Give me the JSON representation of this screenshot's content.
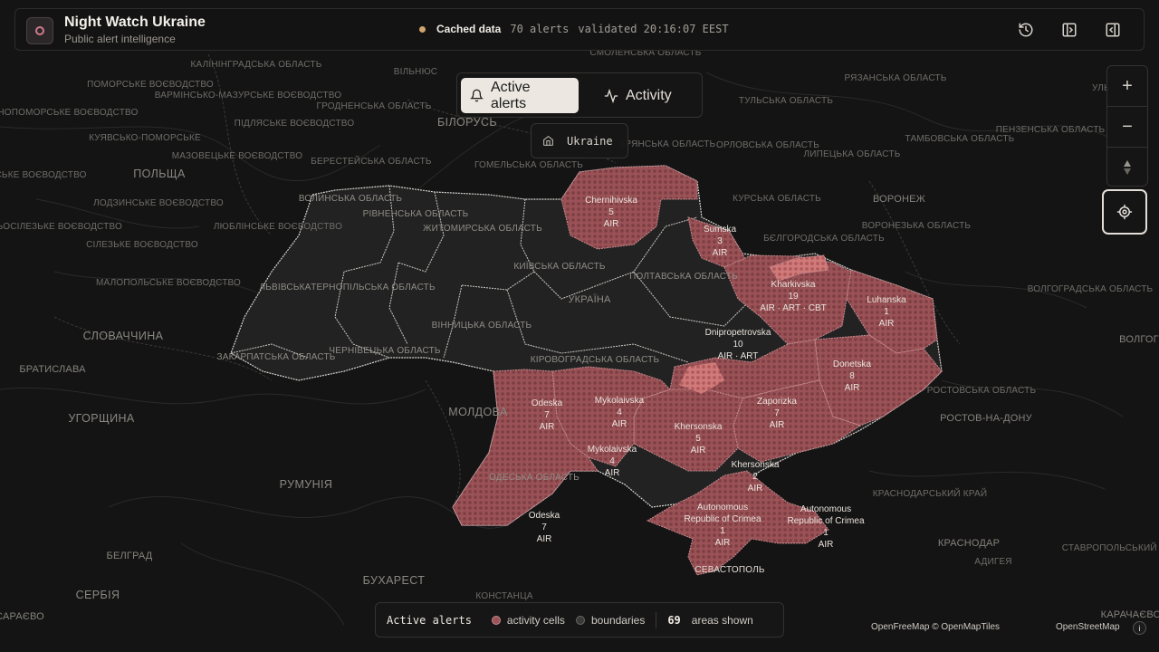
{
  "header": {
    "title": "Night Watch Ukraine",
    "subtitle": "Public alert intelligence",
    "status": "Cached data",
    "alert_count": "70 alerts",
    "validated": "validated 20:16:07 EEST"
  },
  "tabs": [
    {
      "label": "Active alerts",
      "icon": "bell-icon",
      "active": true
    },
    {
      "label": "Activity",
      "icon": "activity-pulse-icon",
      "active": false
    }
  ],
  "breadcrumb": {
    "label": "Ukraine",
    "icon": "home-icon"
  },
  "zoom": {
    "in": "+",
    "out": "−"
  },
  "legend": {
    "title": "Active alerts",
    "cells_label": "activity cells",
    "boundaries_label": "boundaries",
    "count": "69",
    "count_label": "areas shown"
  },
  "attribution": {
    "primary": "OpenFreeMap © OpenMapTiles",
    "secondary": "OpenStreetMap",
    "info": "i"
  },
  "colors": {
    "alert": "#9c5357",
    "alert_edge": "#c48a8e",
    "boundary": "#d9d6d1",
    "background": "#141414"
  },
  "map_labels": {
    "regions": [
      "КАЛІНІНГРАДСЬКА ОБЛАСТЬ",
      "ВІЛЬНЮС",
      "ПОМОРСЬКЕ ВОЄВОДСТВО",
      "ВАРМІНСЬКО-МАЗУРСЬКЕ ВОЄВОДСТВО",
      "ЗАХІДНОПОМОРСЬКЕ ВОЄВОДСТВО",
      "ПІДЛЯСЬКЕ ВОЄВОДСТВО",
      "ГРОДНЕНСЬКА ОБЛАСТЬ",
      "КУЯВСЬКО-ПОМОРСЬКЕ",
      "ПОЛЬЩА",
      "МАЗОВЕЦЬКЕ ВОЄВОДСТВО",
      "БЕРЕСТЕЙСЬКА ОБЛАСТЬ",
      "ЛЮБУСЬКЕ ВОЄВОДСТВО",
      "ЛОДЗИНСЬКЕ ВОЄВОДСТВО",
      "НИЖНЬОСІЛЕЗЬКЕ ВОЄВОДСТВО",
      "ЛЮБЛІНСЬКЕ ВОЄВОДСТВО",
      "СІЛЕЗЬКЕ ВОЄВОДСТВО",
      "МАЛОПОЛЬСЬКЕ ВОЄВОДСТВО",
      "СЛОВАЧЧИНА",
      "БРАТИСЛАВА",
      "УГОРЩИНА",
      "РУМУНІЯ",
      "БУХАРЕСТ",
      "СЕРБІЯ",
      "БЕЛГРАД",
      "САРАЄВО",
      "КОНСТАНЦА",
      "МОЛДОВА",
      "БІЛОРУСЬ",
      "ГОМЕЛЬСЬКА ОБЛАСТЬ",
      "СМОЛЕНСЬКА ОБЛАСТЬ",
      "БРЯНСЬКА ОБЛАСТЬ",
      "ОРЛОВСЬКА ОБЛАСТЬ",
      "ЛИПЕЦЬКА ОБЛАСТЬ",
      "КУРСЬКА ОБЛАСТЬ",
      "ВОРОНЕЖ",
      "ВОРОНЕЗЬКА ОБЛАСТЬ",
      "БЄЛГОРОДСЬКА ОБЛАСТЬ",
      "ТУЛЬСЬКА ОБЛАСТЬ",
      "РЯЗАНСЬКА ОБЛАСТЬ",
      "ТАМБОВСЬКА ОБЛАСТЬ",
      "ПЕНЗЕНСЬКА ОБЛАСТЬ",
      "ВОЛГОГРАДСЬКА ОБЛАСТЬ",
      "ВОЛГОГ",
      "РОСТОВСЬКА ОБЛАСТЬ",
      "РОСТОВ-НА-ДОНУ",
      "КРАСНОДАРСЬКИЙ КРАЙ",
      "КРАСНОДАР",
      "АДИГЕЯ",
      "СТАВРОПОЛЬСЬКИЙ КРАЙ",
      "КАРАЧАЄВО",
      "УЛЬ",
      "ВОЛИНСЬКА ОБЛАСТЬ",
      "РІВНЕНСЬКА ОБЛАСТЬ",
      "ЖИТОМИРСЬКА ОБЛАСТЬ",
      "КИЇВСЬКА ОБЛАСТЬ",
      "ЛЬВІВСЬКА",
      "ТЕРНОПІЛЬСЬКА ОБЛАСТЬ",
      "ЗАКАРПАТСЬКА ОБЛАСТЬ",
      "ЧЕРНІВЕЦЬКА ОБЛАСТЬ",
      "ВІННИЦЬКА ОБЛАСТЬ",
      "УКРАЇНА",
      "ПОЛТАВСЬКА ОБЛАСТЬ",
      "КІРОВОГРАДСЬКА ОБЛАСТЬ",
      "ОДЕСЬКА ОБЛАСТЬ",
      "СЕВАСТОПОЛЬ"
    ],
    "alert_areas": [
      {
        "name": "Chernihivska",
        "count": "5",
        "types": "AIR"
      },
      {
        "name": "Sumska",
        "count": "3",
        "types": "AIR"
      },
      {
        "name": "Kharkivska",
        "count": "19",
        "types": "AIR · ART · CBT"
      },
      {
        "name": "Luhanska",
        "count": "1",
        "types": "AIR"
      },
      {
        "name": "Dnipropetrovska",
        "count": "10",
        "types": "AIR · ART"
      },
      {
        "name": "Donetska",
        "count": "8",
        "types": "AIR"
      },
      {
        "name": "Odeska",
        "count": "7",
        "types": "AIR"
      },
      {
        "name": "Mykolaivska",
        "count": "4",
        "types": "AIR"
      },
      {
        "name": "Zaporizka",
        "count": "7",
        "types": "AIR"
      },
      {
        "name": "Khersonska",
        "count": "5",
        "types": "AIR"
      },
      {
        "name": "Mykolaivska",
        "count": "4",
        "types": "AIR"
      },
      {
        "name": "Khersonska",
        "count": "2",
        "types": "AIR"
      },
      {
        "name": "Odeska",
        "count": "7",
        "types": "AIR"
      },
      {
        "name": "Autonomous Republic of Crimea",
        "count": "1",
        "types": "AIR"
      },
      {
        "name": "Autonomous Republic of Crimea",
        "count": "1",
        "types": "AIR"
      }
    ]
  }
}
